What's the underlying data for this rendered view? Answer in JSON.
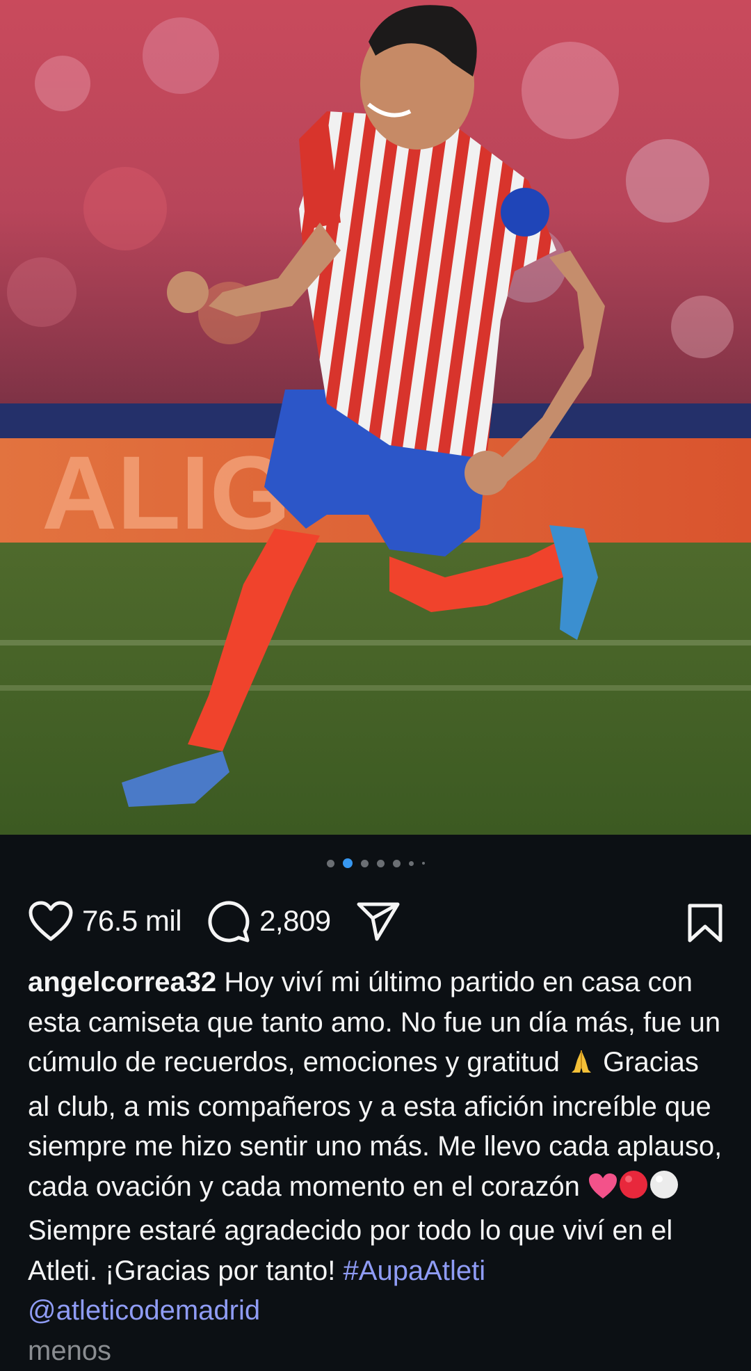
{
  "post": {
    "carousel": {
      "total": 7,
      "active_index": 1
    }
  },
  "actions": {
    "likes": "76.5 mil",
    "comments": "2,809",
    "like_icon": "heart-icon",
    "comment_icon": "comment-icon",
    "share_icon": "send-icon",
    "save_icon": "bookmark-icon"
  },
  "caption": {
    "username": "angelcorrea32",
    "part1": " Hoy viví mi último partido en casa con esta camiseta que tanto amo. No fue un día más, fue un cúmulo de recuerdos, emociones y gratitud ",
    "part2": " Gracias al club, a mis compañeros y a esta afición increíble que siempre me hizo sentir uno más. Me llevo cada aplauso, cada ovación y cada momento en el corazón ",
    "part3": " Siempre estaré agradecido por todo lo que viví en el Atleti. ¡Gracias por tanto! ",
    "hashtag": "#AupaAtleti",
    "mention": "@atleticodemadrid",
    "less_label": "menos"
  },
  "colors": {
    "background": "#0c1014",
    "accent": "#3797f0",
    "link": "#8f9cf5"
  }
}
